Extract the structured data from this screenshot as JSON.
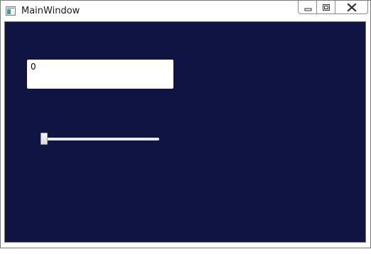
{
  "window": {
    "title": "MainWindow",
    "icon": "app-window-icon",
    "controls": {
      "minimize": "minimize-icon",
      "maximize": "maximize-icon",
      "close": "close-icon"
    }
  },
  "main": {
    "background_color": "#0f1442",
    "textbox": {
      "value": "0"
    },
    "slider": {
      "value": 0
    }
  }
}
